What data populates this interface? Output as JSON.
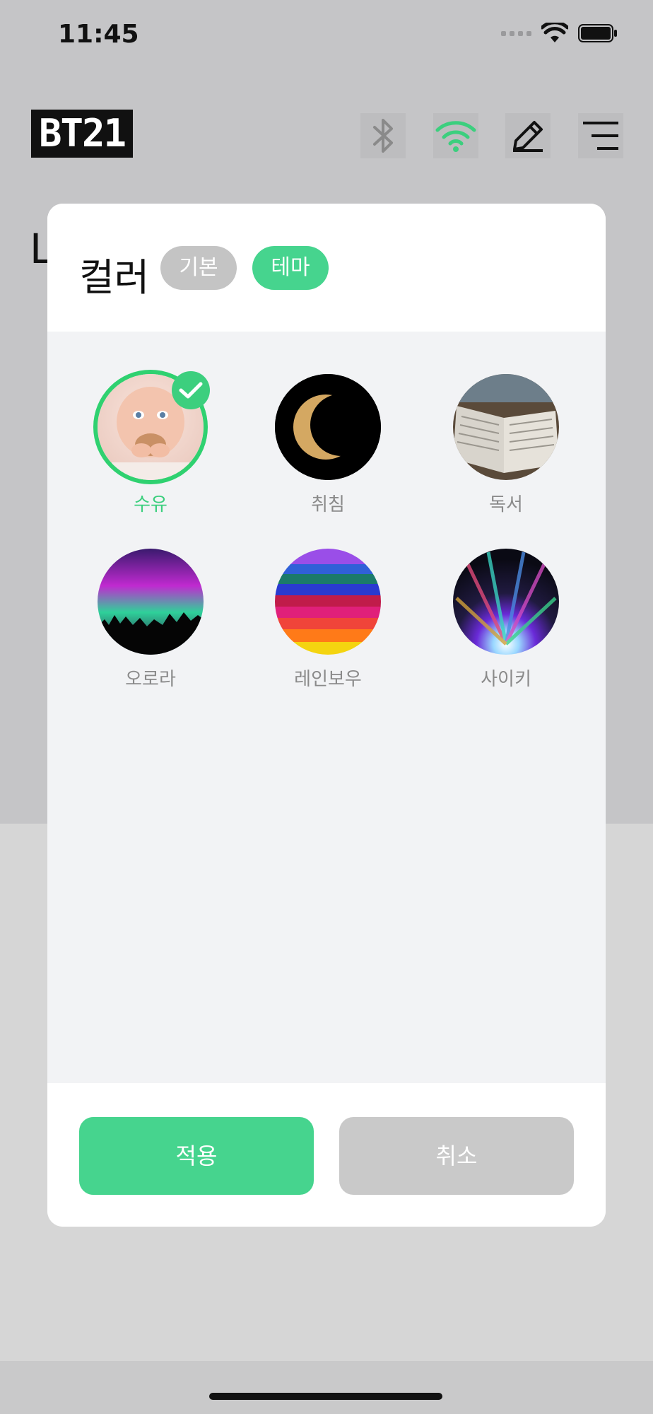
{
  "status_bar": {
    "time": "11:45"
  },
  "header": {
    "logo": "BT21",
    "behind_letter": "L",
    "icons": [
      "bluetooth-icon",
      "wifi-icon",
      "edit-icon",
      "menu-icon"
    ]
  },
  "modal": {
    "title": "컬러",
    "tabs": [
      {
        "label": "기본",
        "active": false
      },
      {
        "label": "테마",
        "active": true
      }
    ],
    "themes": [
      {
        "label": "수유",
        "selected": true,
        "image": "baby"
      },
      {
        "label": "취침",
        "selected": false,
        "image": "moon"
      },
      {
        "label": "독서",
        "selected": false,
        "image": "book"
      },
      {
        "label": "오로라",
        "selected": false,
        "image": "aurora"
      },
      {
        "label": "레인보우",
        "selected": false,
        "image": "rainbow"
      },
      {
        "label": "사이키",
        "selected": false,
        "image": "psychedelic"
      }
    ],
    "buttons": {
      "apply": "적용",
      "cancel": "취소"
    }
  },
  "colors": {
    "accent": "#46d48e",
    "selected_ring": "#2fd170",
    "gray_pill": "#c4c4c4"
  }
}
